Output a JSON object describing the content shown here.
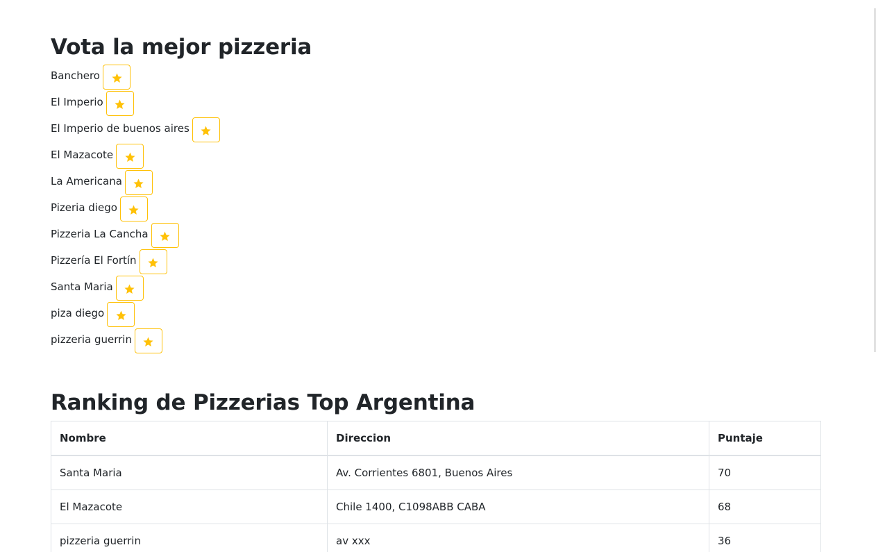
{
  "vote_section": {
    "title": "Vota la mejor pizzeria",
    "items": [
      {
        "label": "Banchero"
      },
      {
        "label": "El Imperio"
      },
      {
        "label": "El Imperio de buenos aires"
      },
      {
        "label": "El Mazacote"
      },
      {
        "label": "La Americana"
      },
      {
        "label": "Pizeria diego"
      },
      {
        "label": "Pizzeria La Cancha"
      },
      {
        "label": "Pizzería El Fortín"
      },
      {
        "label": "Santa Maria"
      },
      {
        "label": "piza diego"
      },
      {
        "label": "pizzeria guerrin"
      }
    ],
    "button_icon": "star-icon",
    "accent_color": "#ffc107"
  },
  "ranking_section": {
    "title": "Ranking de Pizzerias Top Argentina",
    "columns": [
      "Nombre",
      "Direccion",
      "Puntaje"
    ],
    "rows": [
      {
        "name": "Santa Maria",
        "address": "Av. Corrientes 6801, Buenos Aires",
        "score": "70"
      },
      {
        "name": "El Mazacote",
        "address": "Chile 1400, C1098ABB CABA",
        "score": "68"
      },
      {
        "name": "pizzeria guerrin",
        "address": "av xxx",
        "score": "36"
      }
    ]
  }
}
